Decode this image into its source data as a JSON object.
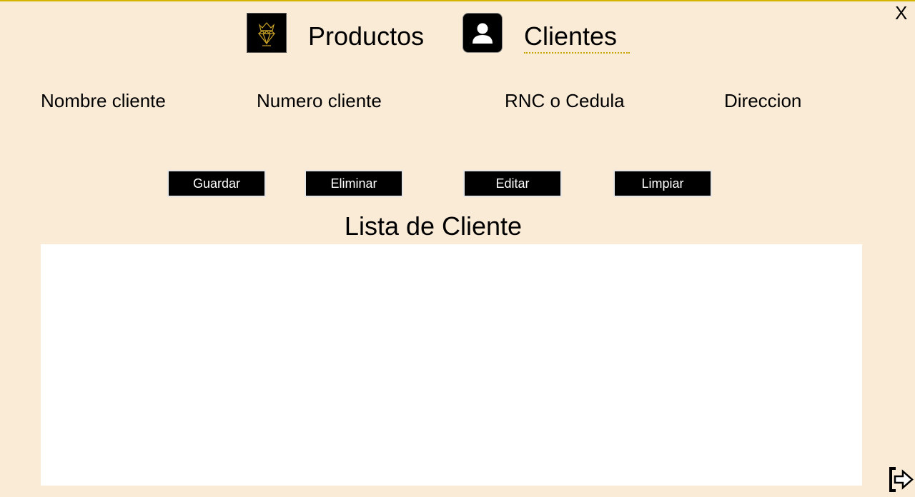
{
  "window": {
    "close_label": "X"
  },
  "nav": {
    "productos": {
      "label": "Productos",
      "icon": "diamond-crown-logo-icon"
    },
    "clientes": {
      "label": "Clientes",
      "icon": "user-icon"
    }
  },
  "form": {
    "fields": [
      {
        "label": "Nombre cliente"
      },
      {
        "label": "Numero cliente"
      },
      {
        "label": "RNC o Cedula"
      },
      {
        "label": "Direccion"
      }
    ]
  },
  "actions": {
    "guardar": "Guardar",
    "eliminar": "Eliminar",
    "editar": "Editar",
    "limpiar": "Limpiar"
  },
  "list": {
    "title": "Lista de Cliente",
    "rows": []
  },
  "footer": {
    "exit_icon": "exit-arrow-icon"
  },
  "colors": {
    "background": "#faebd7",
    "button": "#000000",
    "accent": "#d4b400"
  }
}
